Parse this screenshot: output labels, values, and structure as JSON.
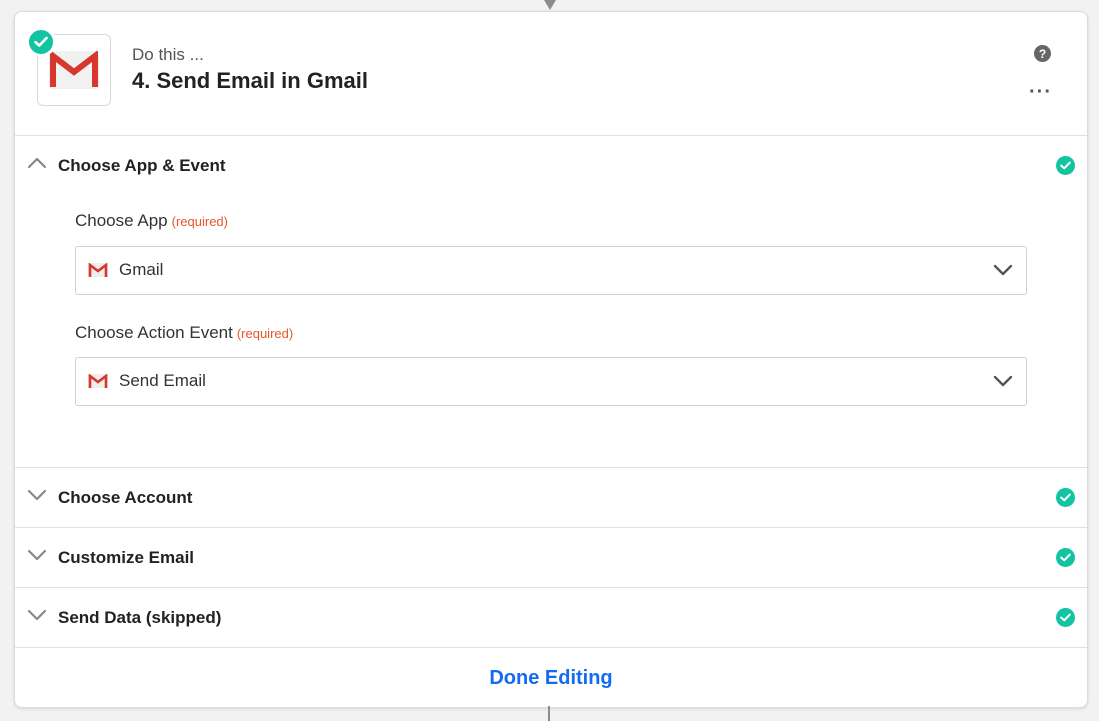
{
  "step": {
    "eyebrow": "Do this ...",
    "title": "4. Send Email in Gmail",
    "help_icon": "question-circle-icon",
    "more_icon": "ellipsis-icon",
    "app_icon": "gmail-logo-icon"
  },
  "sections": [
    {
      "title": "Choose App & Event",
      "state": "expanded",
      "complete": true
    },
    {
      "title": "Choose Account",
      "state": "collapsed",
      "complete": true
    },
    {
      "title": "Customize Email",
      "state": "collapsed",
      "complete": true
    },
    {
      "title": "Send Data (skipped)",
      "state": "collapsed",
      "complete": true
    }
  ],
  "fields": {
    "app": {
      "label": "Choose App",
      "required": "(required)",
      "value": "Gmail"
    },
    "event": {
      "label": "Choose Action Event",
      "required": "(required)",
      "value": "Send Email"
    }
  },
  "footer": {
    "done_label": "Done Editing"
  },
  "colors": {
    "success": "#13c4a3",
    "link": "#136bf5",
    "required": "#e8552b"
  }
}
